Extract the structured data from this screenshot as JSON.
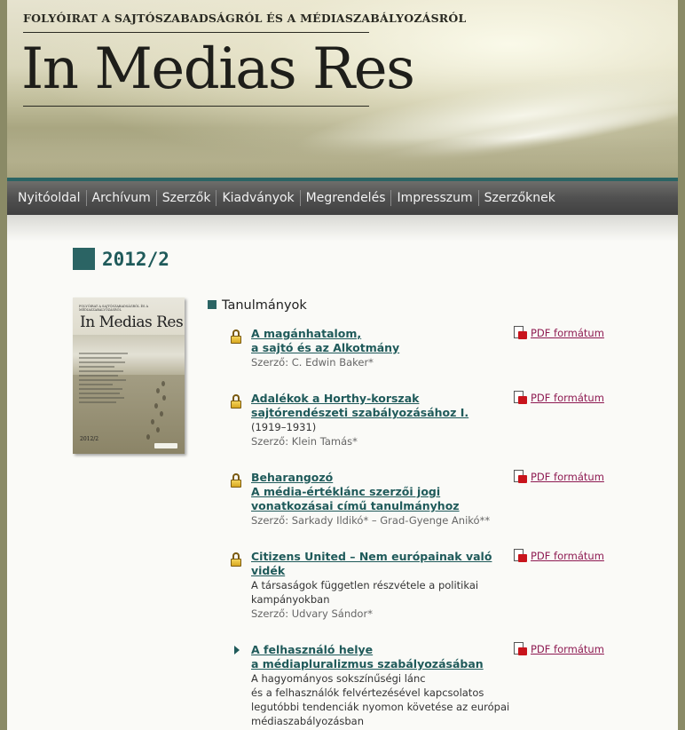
{
  "header": {
    "tagline": "FOLYÓIRAT A SAJTÓSZABADSÁGRÓL ÉS A MÉDIASZABÁLYOZÁSRÓL",
    "title": "In Medias Res"
  },
  "nav": {
    "items": [
      {
        "label": "Nyitóoldal"
      },
      {
        "label": "Archívum"
      },
      {
        "label": "Szerzők"
      },
      {
        "label": "Kiadványok"
      },
      {
        "label": "Megrendelés"
      },
      {
        "label": "Impresszum"
      },
      {
        "label": "Szerzőknek"
      }
    ]
  },
  "issue": {
    "title": "2012/2"
  },
  "cover": {
    "tagline": "FOLYÓIRAT A SAJTÓSZABADSÁGRÓL ÉS A MÉDIASZABÁLYOZÁSRÓL",
    "title": "In Medias Res",
    "issue": "2012/2"
  },
  "section": {
    "title": "Tanulmányok"
  },
  "pdf_label": "PDF formátum",
  "articles": [
    {
      "title": "A magánhatalom,\na sajtó és az Alkotmány",
      "subtitle": "",
      "author": "Szerző: C. Edwin Baker*",
      "icon": "lock-icon"
    },
    {
      "title": "Adalékok a Horthy-korszak\nsajtórendészeti szabályozásához I.",
      "subtitle": "(1919–1931)",
      "author": "Szerző: Klein Tamás*",
      "icon": "lock-icon"
    },
    {
      "title": "Beharangozó\nA média-értéklánc szerzői jogi\nvonatkozásai című tanulmányhoz",
      "subtitle": "",
      "author": "Szerző: Sarkady Ildikó* – Grad-Gyenge Anikó**",
      "icon": "lock-icon"
    },
    {
      "title": "Citizens United – Nem európainak való\nvidék",
      "subtitle": "A társaságok független részvétele a politikai\nkampányokban",
      "author": "Szerző: Udvary Sándor*",
      "icon": "lock-icon"
    },
    {
      "title": "A felhasználó helye\na médiapluralizmus szabályozásában",
      "subtitle": "A hagyományos sokszínűségi lánc\nés a felhasználók felvértezésével kapcsolatos\nlegutóbbi tendenciák nyomon követése az európai\nmédiaszabályozásban",
      "author": "",
      "icon": "arrow-right-icon"
    }
  ]
}
